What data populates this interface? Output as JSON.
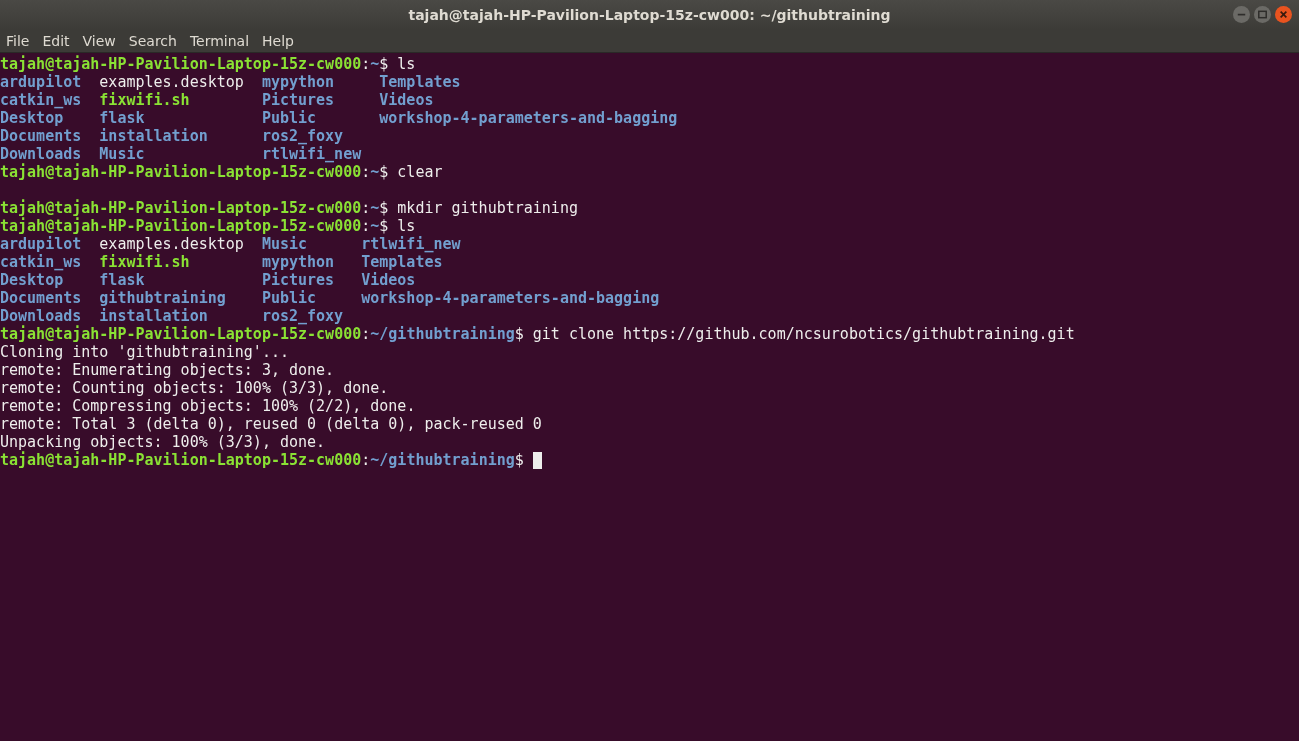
{
  "window": {
    "title": "tajah@tajah-HP-Pavilion-Laptop-15z-cw000: ~/githubtraining"
  },
  "menu": [
    "File",
    "Edit",
    "View",
    "Search",
    "Terminal",
    "Help"
  ],
  "lines": [
    {
      "kind": "prompt",
      "user_host": "tajah@tajah-HP-Pavilion-Laptop-15z-cw000",
      "colon": ":",
      "path": "~",
      "sign": "$",
      "command": "ls"
    },
    {
      "kind": "listing",
      "rows": [
        [
          {
            "text": "ardupilot",
            "kind": "dir"
          },
          {
            "text": "examples.desktop",
            "kind": "file"
          },
          {
            "text": "mypython",
            "kind": "dir"
          },
          {
            "text": "Templates",
            "kind": "dir"
          }
        ],
        [
          {
            "text": "catkin_ws",
            "kind": "dir"
          },
          {
            "text": "fixwifi.sh",
            "kind": "exec"
          },
          {
            "text": "Pictures",
            "kind": "dir"
          },
          {
            "text": "Videos",
            "kind": "dir"
          }
        ],
        [
          {
            "text": "Desktop",
            "kind": "dir"
          },
          {
            "text": "flask",
            "kind": "dir"
          },
          {
            "text": "Public",
            "kind": "dir"
          },
          {
            "text": "workshop-4-parameters-and-bagging",
            "kind": "dir"
          }
        ],
        [
          {
            "text": "Documents",
            "kind": "dir"
          },
          {
            "text": "installation",
            "kind": "dir"
          },
          {
            "text": "ros2_foxy",
            "kind": "dir"
          }
        ],
        [
          {
            "text": "Downloads",
            "kind": "dir"
          },
          {
            "text": "Music",
            "kind": "dir"
          },
          {
            "text": "rtlwifi_new",
            "kind": "dir"
          }
        ]
      ]
    },
    {
      "kind": "prompt",
      "user_host": "tajah@tajah-HP-Pavilion-Laptop-15z-cw000",
      "colon": ":",
      "path": "~",
      "sign": "$",
      "command": "clear"
    },
    {
      "kind": "blank"
    },
    {
      "kind": "prompt",
      "user_host": "tajah@tajah-HP-Pavilion-Laptop-15z-cw000",
      "colon": ":",
      "path": "~",
      "sign": "$",
      "command": "mkdir githubtraining"
    },
    {
      "kind": "prompt",
      "user_host": "tajah@tajah-HP-Pavilion-Laptop-15z-cw000",
      "colon": ":",
      "path": "~",
      "sign": "$",
      "command": "ls"
    },
    {
      "kind": "listing",
      "rows": [
        [
          {
            "text": "ardupilot",
            "kind": "dir"
          },
          {
            "text": "examples.desktop",
            "kind": "file"
          },
          {
            "text": "Music",
            "kind": "dir"
          },
          {
            "text": "rtlwifi_new",
            "kind": "dir"
          }
        ],
        [
          {
            "text": "catkin_ws",
            "kind": "dir"
          },
          {
            "text": "fixwifi.sh",
            "kind": "exec"
          },
          {
            "text": "mypython",
            "kind": "dir"
          },
          {
            "text": "Templates",
            "kind": "dir"
          }
        ],
        [
          {
            "text": "Desktop",
            "kind": "dir"
          },
          {
            "text": "flask",
            "kind": "dir"
          },
          {
            "text": "Pictures",
            "kind": "dir"
          },
          {
            "text": "Videos",
            "kind": "dir"
          }
        ],
        [
          {
            "text": "Documents",
            "kind": "dir"
          },
          {
            "text": "githubtraining",
            "kind": "dir"
          },
          {
            "text": "Public",
            "kind": "dir"
          },
          {
            "text": "workshop-4-parameters-and-bagging",
            "kind": "dir"
          }
        ],
        [
          {
            "text": "Downloads",
            "kind": "dir"
          },
          {
            "text": "installation",
            "kind": "dir"
          },
          {
            "text": "ros2_foxy",
            "kind": "dir"
          }
        ]
      ]
    },
    {
      "kind": "prompt",
      "user_host": "tajah@tajah-HP-Pavilion-Laptop-15z-cw000",
      "colon": ":",
      "path": "~/githubtraining",
      "sign": "$",
      "command": "git clone https://github.com/ncsurobotics/githubtraining.git"
    },
    {
      "kind": "output",
      "text": "Cloning into 'githubtraining'..."
    },
    {
      "kind": "output",
      "text": "remote: Enumerating objects: 3, done."
    },
    {
      "kind": "output",
      "text": "remote: Counting objects: 100% (3/3), done."
    },
    {
      "kind": "output",
      "text": "remote: Compressing objects: 100% (2/2), done."
    },
    {
      "kind": "output",
      "text": "remote: Total 3 (delta 0), reused 0 (delta 0), pack-reused 0"
    },
    {
      "kind": "output",
      "text": "Unpacking objects: 100% (3/3), done."
    },
    {
      "kind": "prompt",
      "user_host": "tajah@tajah-HP-Pavilion-Laptop-15z-cw000",
      "colon": ":",
      "path": "~/githubtraining",
      "sign": "$",
      "cursor": true
    }
  ]
}
